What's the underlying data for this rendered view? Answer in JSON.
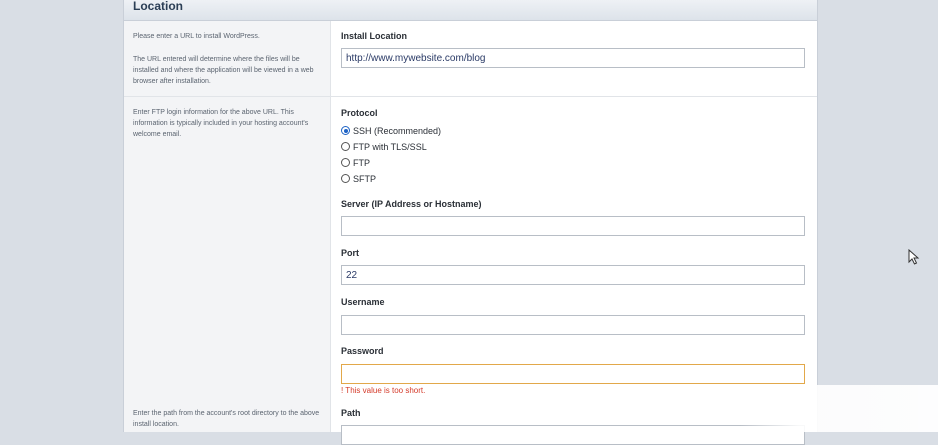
{
  "header": {
    "title": "Location"
  },
  "location_section": {
    "help_1": "Please enter a URL to install WordPress.",
    "help_2": "The URL entered will determine where the files will be installed and where the application will be viewed in a web browser after installation.",
    "install_label": "Install Location",
    "install_value": "http://www.mywebsite.com/blog"
  },
  "ftp_section": {
    "help": "Enter FTP login information for the above URL. This information is typically included in your hosting account's welcome email.",
    "protocol_label": "Protocol",
    "protocols": [
      {
        "label": "SSH (Recommended)",
        "checked": true
      },
      {
        "label": "FTP with TLS/SSL",
        "checked": false
      },
      {
        "label": "FTP",
        "checked": false
      },
      {
        "label": "SFTP",
        "checked": false
      }
    ],
    "server_label": "Server (IP Address or Hostname)",
    "server_value": "",
    "port_label": "Port",
    "port_value": "22",
    "username_label": "Username",
    "username_value": "",
    "password_label": "Password",
    "password_value": "",
    "password_error": "! This value is too short."
  },
  "path_section": {
    "help": "Enter the path from the account's root directory to the above install location.",
    "path_label": "Path"
  },
  "colors": {
    "accent": "#1e63c5",
    "error": "#d43a2a",
    "error_border": "#e2a84a"
  }
}
